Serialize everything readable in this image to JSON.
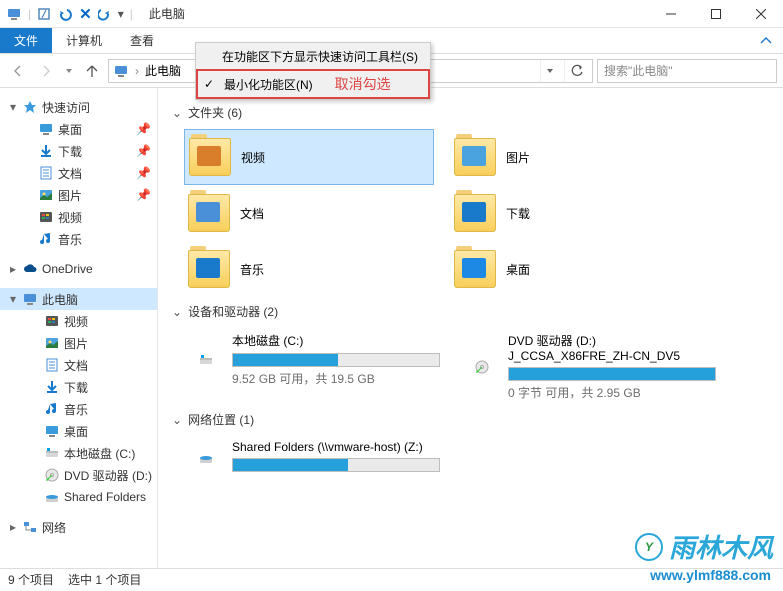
{
  "title": "此电脑",
  "ribbon": {
    "file": "文件",
    "computer": "计算机",
    "view": "查看"
  },
  "menu": {
    "show_qat": "在功能区下方显示快速访问工具栏(S)",
    "minimize_ribbon": "最小化功能区(N)",
    "cancel_note": "取消勾选"
  },
  "address": {
    "location": "此电脑",
    "search_placeholder": "搜索\"此电脑\""
  },
  "sidebar": [
    {
      "label": "快速访问",
      "chv": "▾",
      "icon": "star"
    },
    {
      "label": "桌面",
      "indent": 1,
      "icon": "desktop",
      "pin": true
    },
    {
      "label": "下载",
      "indent": 1,
      "icon": "download",
      "pin": true
    },
    {
      "label": "文档",
      "indent": 1,
      "icon": "doc",
      "pin": true
    },
    {
      "label": "图片",
      "indent": 1,
      "icon": "pic",
      "pin": true
    },
    {
      "label": "视频",
      "indent": 1,
      "icon": "video"
    },
    {
      "label": "音乐",
      "indent": 1,
      "icon": "music"
    },
    {
      "spacer": true
    },
    {
      "label": "OneDrive",
      "chv": "▸",
      "icon": "cloud"
    },
    {
      "spacer": true
    },
    {
      "label": "此电脑",
      "chv": "▾",
      "icon": "pc",
      "sel": true
    },
    {
      "label": "视频",
      "indent": 2,
      "icon": "video"
    },
    {
      "label": "图片",
      "indent": 2,
      "icon": "pic"
    },
    {
      "label": "文档",
      "indent": 2,
      "icon": "doc"
    },
    {
      "label": "下载",
      "indent": 2,
      "icon": "download"
    },
    {
      "label": "音乐",
      "indent": 2,
      "icon": "music"
    },
    {
      "label": "桌面",
      "indent": 2,
      "icon": "desktop"
    },
    {
      "label": "本地磁盘 (C:)",
      "indent": 2,
      "icon": "disk"
    },
    {
      "label": "DVD 驱动器 (D:)",
      "indent": 2,
      "icon": "dvd"
    },
    {
      "label": "Shared Folders",
      "indent": 2,
      "icon": "net"
    },
    {
      "spacer": true
    },
    {
      "label": "网络",
      "chv": "▸",
      "icon": "net2"
    }
  ],
  "sections": {
    "folders": {
      "title": "文件夹 (6)",
      "items": [
        {
          "name": "视频",
          "badge": "#d97f2b",
          "sel": true
        },
        {
          "name": "图片",
          "badge": "#4aa3df"
        },
        {
          "name": "文档",
          "badge": "#4a90d9"
        },
        {
          "name": "下载",
          "badge": "#1979ca"
        },
        {
          "name": "音乐",
          "badge": "#1979ca"
        },
        {
          "name": "桌面",
          "badge": "#1e88e5"
        }
      ]
    },
    "devices": {
      "title": "设备和驱动器 (2)",
      "items": [
        {
          "name": "本地磁盘 (C:)",
          "sub": "9.52 GB 可用，共 19.5 GB",
          "fill": 51,
          "icon": "disk"
        },
        {
          "name": "DVD 驱动器 (D:) J_CCSA_X86FRE_ZH-CN_DV5",
          "sub": "0 字节 可用，共 2.95 GB",
          "fill": 100,
          "icon": "dvd"
        }
      ]
    },
    "network": {
      "title": "网络位置 (1)",
      "items": [
        {
          "name": "Shared Folders (\\\\vmware-host) (Z:)",
          "sub": "",
          "fill": 56,
          "icon": "net"
        }
      ]
    }
  },
  "status": {
    "count": "9 个项目",
    "selected": "选中 1 个项目"
  },
  "watermark": {
    "brand": "雨林木风",
    "url": "www.ylmf888.com"
  }
}
